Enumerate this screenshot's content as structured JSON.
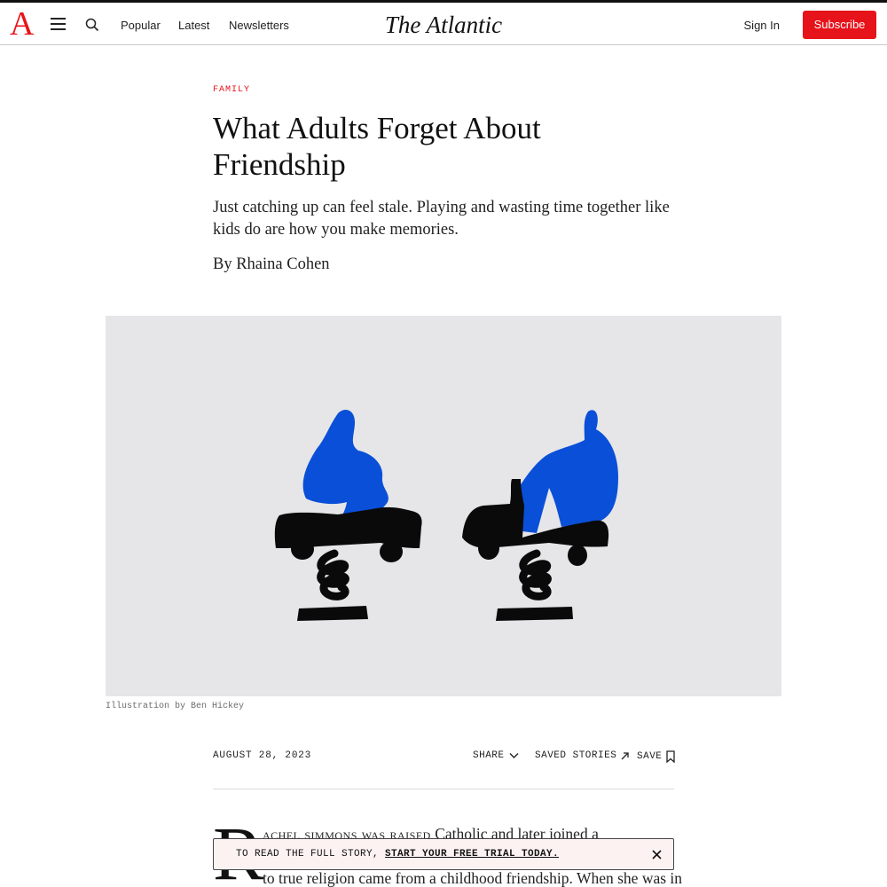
{
  "header": {
    "logo_letter": "A",
    "nav": [
      "Popular",
      "Latest",
      "Newsletters"
    ],
    "brand": "The Atlantic",
    "signin_label": "Sign In",
    "subscribe_label": "Subscribe"
  },
  "article": {
    "section": "FAMILY",
    "headline": "What Adults Forget About Friendship",
    "dek": "Just catching up can feel stale. Playing and wasting time together like kids do are how you make memories.",
    "byline": "By Rhaina Cohen",
    "caption": "Illustration by Ben Hickey",
    "date": "AUGUST 28, 2023",
    "actions": {
      "share": "SHARE",
      "saved": "SAVED STORIES",
      "save": "SAVE"
    },
    "dropcap": "R",
    "body": {
      "line1_smallcaps": "achel simmons was raised",
      "line1_rest": " Catholic and later joined a",
      "line3": "to true religion came from a childhood friendship. When she was in"
    }
  },
  "paywall": {
    "text": "TO READ THE FULL STORY, ",
    "link": "START YOUR FREE TRIAL TODAY."
  },
  "colors": {
    "brand_red": "#e7131a",
    "figure_blue": "#0a4fd8",
    "hero_bg": "#e6e6e8"
  },
  "icons": [
    "menu-icon",
    "search-icon",
    "chevron-down-icon",
    "arrow-up-right-icon",
    "bookmark-icon",
    "close-icon"
  ]
}
